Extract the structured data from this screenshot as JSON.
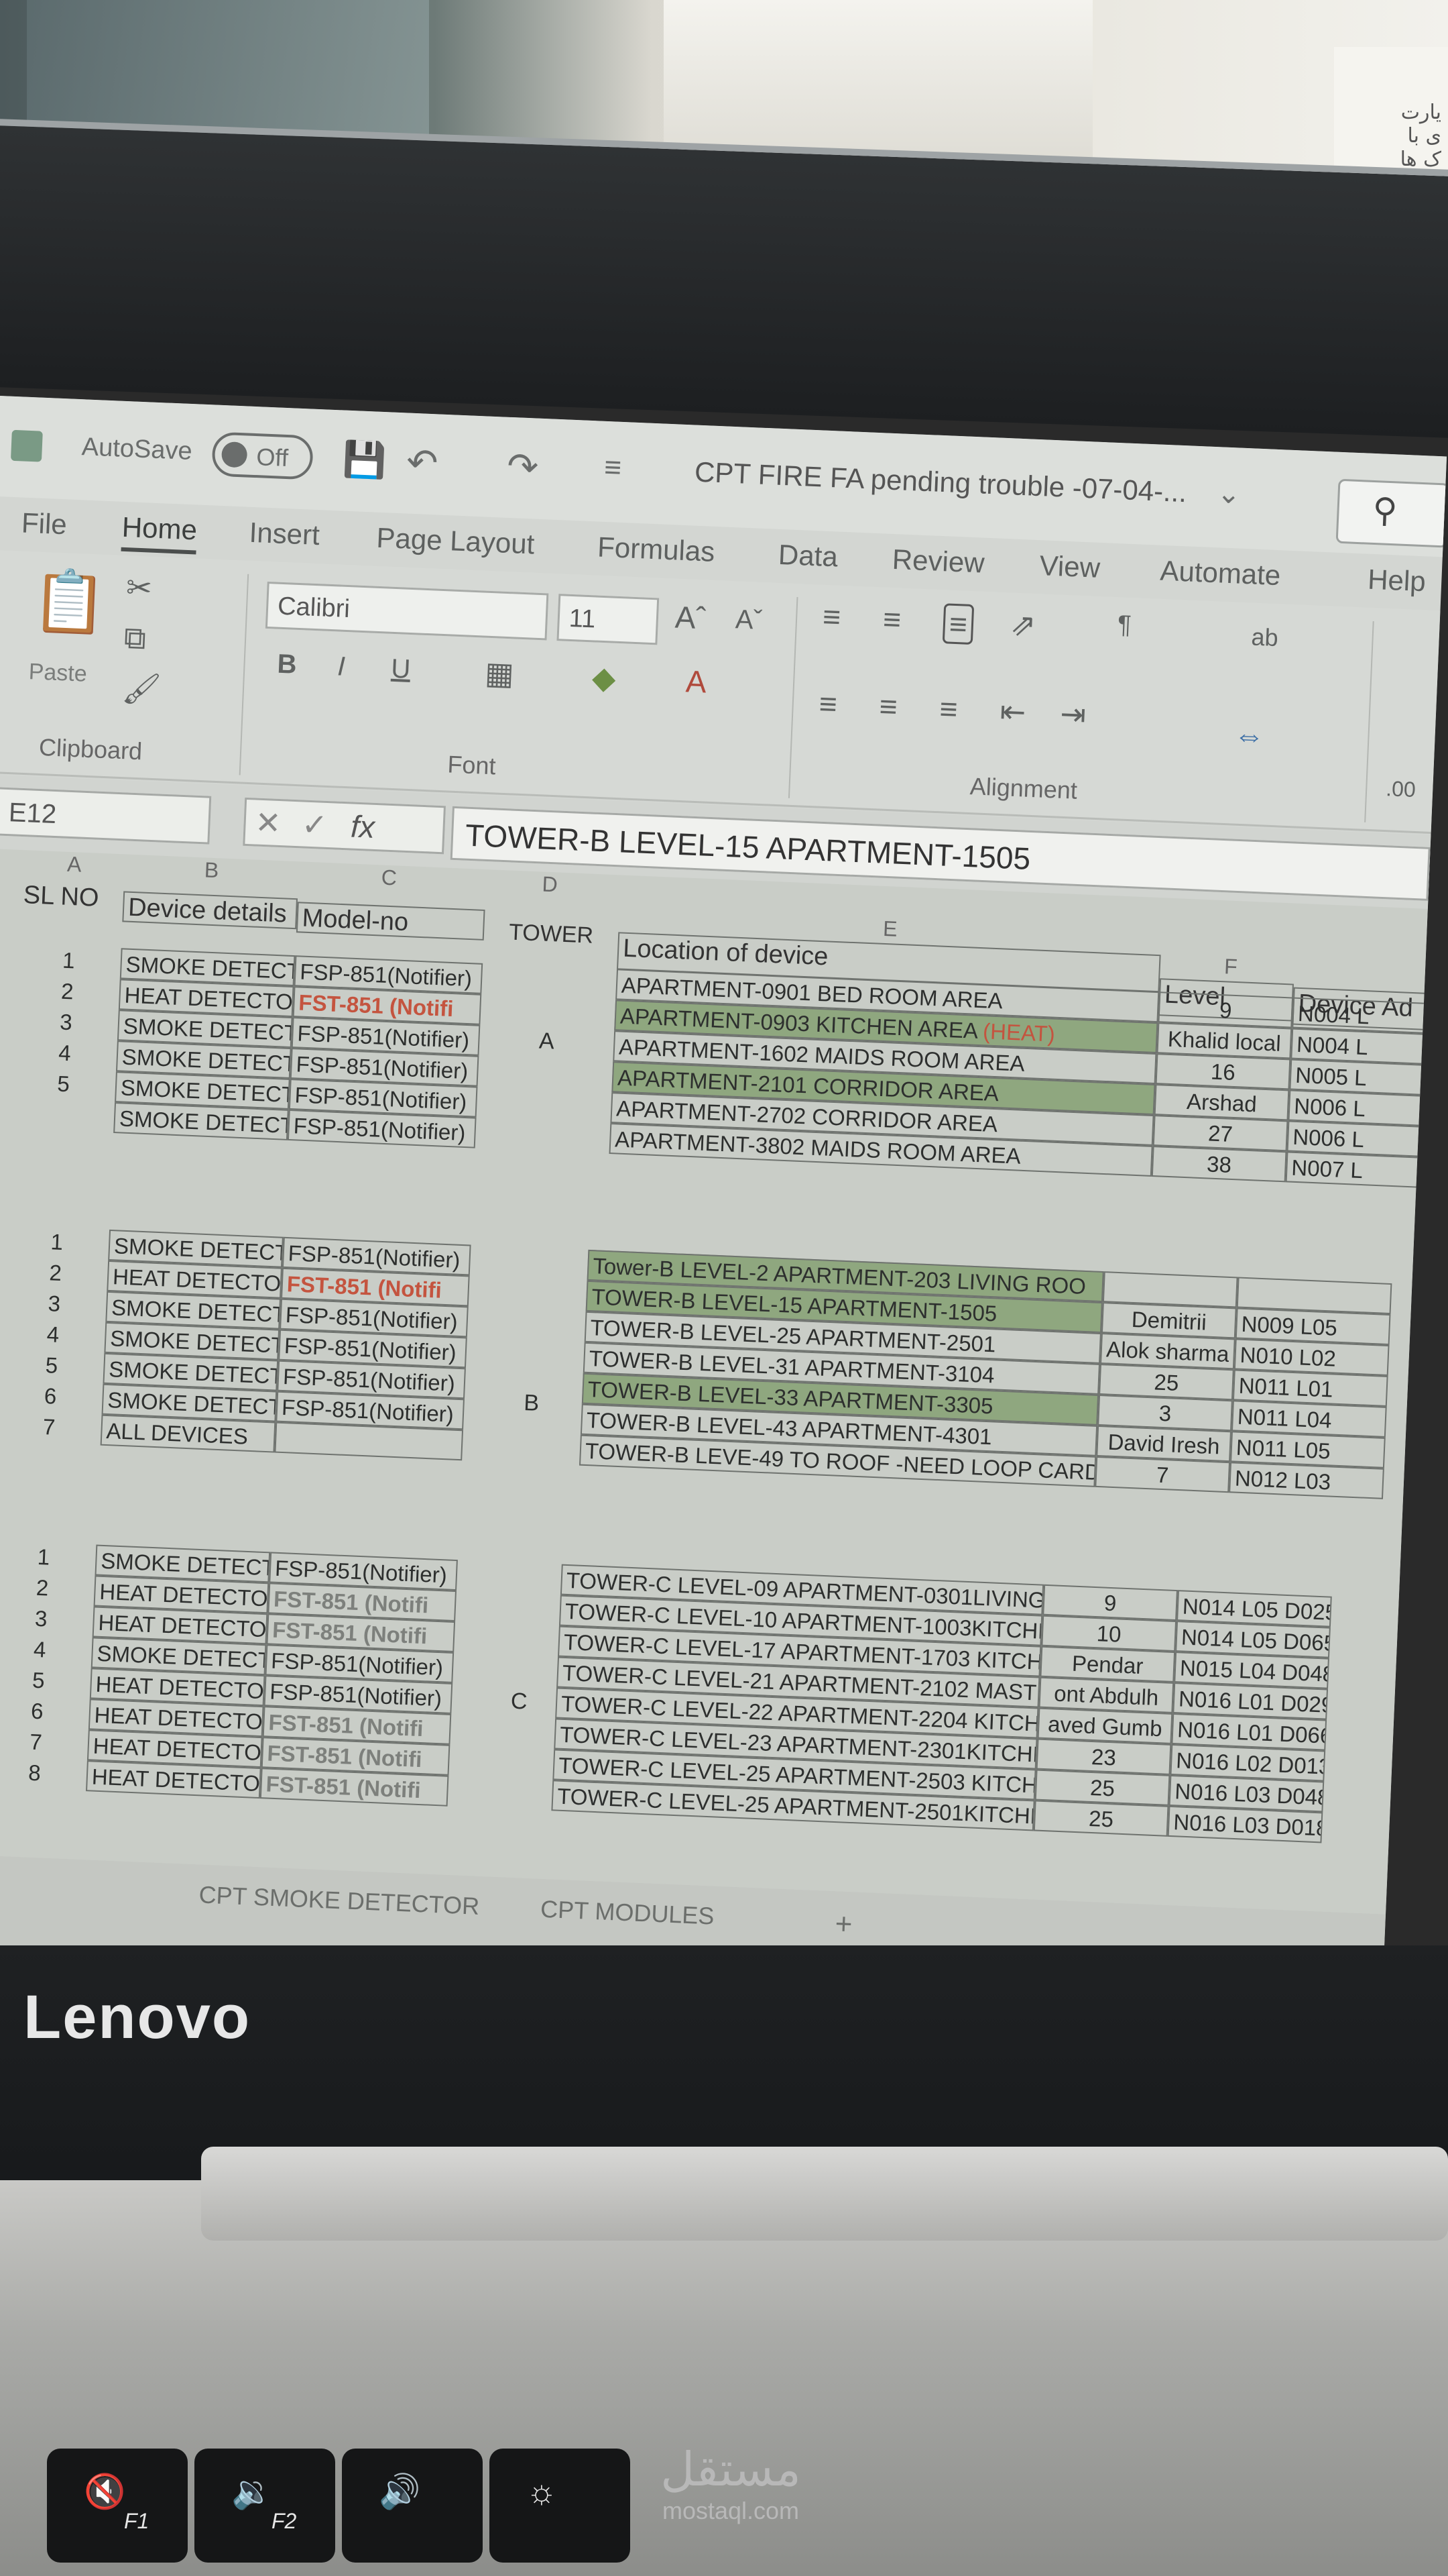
{
  "environment": {
    "right_doc_text": "یارت\nی با\nک ها"
  },
  "app": {
    "autosave_label": "AutoSave",
    "autosave_state": "Off",
    "title": "CPT FIRE FA pending trouble -07-04-...",
    "brand": "Lenovo"
  },
  "menu": [
    "File",
    "Home",
    "Insert",
    "Page Layout",
    "Formulas",
    "Data",
    "Review",
    "View",
    "Automate",
    "Help"
  ],
  "ribbon": {
    "clipboard_label": "Clipboard",
    "paste_label": "Paste",
    "font_name": "Calibri",
    "font_size": "11",
    "font_label": "Font",
    "alignment_label": "Alignment",
    "bold": "B",
    "italic": "I",
    "underline": "U",
    "number_partial": ".00"
  },
  "formula_bar": {
    "name_box": "E12",
    "fx": "fx",
    "content": "TOWER-B LEVEL-15 APARTMENT-1505"
  },
  "columns": [
    "A",
    "B",
    "C",
    "D",
    "E",
    "F"
  ],
  "headers": {
    "sl_no": "SL NO",
    "device_details": "Device details",
    "model_no": "Model-no",
    "tower": "TOWER",
    "location": "Location of device",
    "level": "Level",
    "device_address": "Device Ad"
  },
  "tower_a": {
    "tower": "A",
    "rows": [
      {
        "sl": "1",
        "device": "SMOKE DETECTO",
        "model": "FSP-851(Notifier)",
        "location": "APARTMENT-0901 BED ROOM AREA",
        "level": "9",
        "address": "N004 L"
      },
      {
        "sl": "2",
        "device": "HEAT DETECTOR",
        "model": "FST-851 (Notifi",
        "location": "APARTMENT-0903 KITCHEN AREA",
        "location_tag": "(HEAT)",
        "level": "Khalid local",
        "address": "N004 L"
      },
      {
        "sl": "3",
        "device": "SMOKE DETECTO",
        "model": "FSP-851(Notifier)",
        "location": "APARTMENT-1602 MAIDS ROOM AREA",
        "level": "16",
        "address": "N005 L"
      },
      {
        "sl": "4",
        "device": "SMOKE DETECTO",
        "model": "FSP-851(Notifier)",
        "location": "APARTMENT-2101 CORRIDOR AREA",
        "level": "Arshad",
        "address": "N006 L"
      },
      {
        "sl": "5",
        "device": "SMOKE DETECTO",
        "model": "FSP-851(Notifier)",
        "location": "APARTMENT-2702 CORRIDOR AREA",
        "level": "27",
        "address": "N006 L"
      },
      {
        "sl": "",
        "device": "SMOKE DETECTO",
        "model": "FSP-851(Notifier)",
        "location": "APARTMENT-3802 MAIDS ROOM AREA",
        "level": "38",
        "address": "N007 L"
      }
    ]
  },
  "tower_b": {
    "tower": "B",
    "rows": [
      {
        "sl": "1",
        "device": "SMOKE DETECTO",
        "model": "FSP-851(Notifier)",
        "location": "Tower-B LEVEL-2 APARTMENT-203 LIVING ROO",
        "level": "",
        "address": ""
      },
      {
        "sl": "2",
        "device": "HEAT DETECTOR",
        "model": "FST-851 (Notifi",
        "location": "TOWER-B LEVEL-15 APARTMENT-1505",
        "level": "Demitrii",
        "address": "N009 L05"
      },
      {
        "sl": "3",
        "device": "SMOKE DETECTO",
        "model": "FSP-851(Notifier)",
        "location": "TOWER-B LEVEL-25 APARTMENT-2501",
        "level": "Alok sharma",
        "address": "N010 L02"
      },
      {
        "sl": "4",
        "device": "SMOKE DETECTO",
        "model": "FSP-851(Notifier)",
        "location": "TOWER-B LEVEL-31 APARTMENT-3104",
        "level": "25",
        "address": "N011 L01"
      },
      {
        "sl": "5",
        "device": "SMOKE DETECTO",
        "model": "FSP-851(Notifier)",
        "location": "TOWER-B LEVEL-33 APARTMENT-3305",
        "level": "3",
        "address": "N011 L04"
      },
      {
        "sl": "6",
        "device": "SMOKE DETECTO",
        "model": "FSP-851(Notifier)",
        "location": "TOWER-B LEVEL-43 APARTMENT-4301",
        "level": "David Iresh",
        "address": "N011 L05"
      },
      {
        "sl": "7",
        "device": "ALL DEVICES",
        "model": "",
        "location": "TOWER-B LEVE-49 TO ROOF -NEED LOOP CARD",
        "level": "7",
        "address": "N012 L03"
      }
    ]
  },
  "tower_c": {
    "tower": "C",
    "rows": [
      {
        "sl": "1",
        "device": "SMOKE DETECTO",
        "model": "FSP-851(Notifier)",
        "location": "TOWER-C LEVEL-09 APARTMENT-0301LIVING",
        "level": "9",
        "address": "N014 L05 D025"
      },
      {
        "sl": "2",
        "device": "HEAT DETECTOR",
        "model": "FST-851 (Notifi",
        "location": "TOWER-C LEVEL-10 APARTMENT-1003KITCHEN",
        "level": "10",
        "address": "N014 L05 D065"
      },
      {
        "sl": "3",
        "device": "HEAT DETECTOR",
        "model": "FST-851 (Notifi",
        "location": "TOWER-C LEVEL-17 APARTMENT-1703 KITCHEN",
        "level": "Pendar",
        "address": "N015 L04 D048"
      },
      {
        "sl": "4",
        "device": "SMOKE DETECTO",
        "model": "FSP-851(Notifier)",
        "location": "TOWER-C LEVEL-21 APARTMENT-2102 MASTER",
        "level": "ont Abdulh",
        "address": "N016 L01 D029"
      },
      {
        "sl": "5",
        "device": "HEAT DETECTOR",
        "model": "FSP-851(Notifier)",
        "location": "TOWER-C LEVEL-22 APARTMENT-2204 KITCHEN",
        "level": "aved Gumb",
        "address": "N016 L01 D066"
      },
      {
        "sl": "6",
        "device": "HEAT DETECTOR",
        "model": "FST-851 (Notifi",
        "location": "TOWER-C LEVEL-23 APARTMENT-2301KITCHE",
        "level": "23",
        "address": "N016 L02 D013"
      },
      {
        "sl": "7",
        "device": "HEAT DETECTOR",
        "model": "FST-851 (Notifi",
        "location": "TOWER-C LEVEL-25 APARTMENT-2503 KITCHE",
        "level": "25",
        "address": "N016 L03 D048"
      },
      {
        "sl": "8",
        "device": "HEAT DETECTOR",
        "model": "FST-851 (Notifi",
        "location": "TOWER-C LEVEL-25 APARTMENT-2501KITCHE",
        "level": "25",
        "address": "N016 L03 D018"
      }
    ]
  },
  "sheet_tabs": [
    "CPT SMOKE DETECTOR",
    "CPT MODULES",
    "+"
  ],
  "keys": [
    {
      "label": "F1",
      "icon": "mute-icon"
    },
    {
      "label": "F2",
      "icon": "volume-down-icon"
    },
    {
      "label": "",
      "icon": "volume-up-icon"
    },
    {
      "label": "",
      "icon": "brightness-icon"
    }
  ],
  "watermark": {
    "arabic": "مستقل",
    "latin": "mostaql.com"
  }
}
